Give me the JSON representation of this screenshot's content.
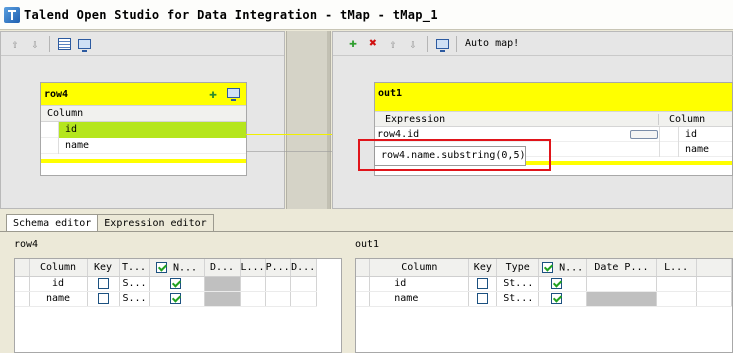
{
  "window": {
    "title": "Talend Open Studio for Data Integration - tMap - tMap_1"
  },
  "left_toolbar": {
    "icons": [
      "arrow-up-icon",
      "arrow-down-icon",
      "table-icon",
      "screen-icon"
    ]
  },
  "right_toolbar": {
    "icons": [
      "add-icon",
      "delete-icon",
      "arrow-up-icon",
      "arrow-down-icon",
      "screen-icon"
    ],
    "auto_map_label": "Auto map!"
  },
  "input_table": {
    "name": "row4",
    "column_header": "Column",
    "rows": [
      {
        "column": "id",
        "selected": true
      },
      {
        "column": "name",
        "selected": false
      }
    ]
  },
  "output_table": {
    "name": "out1",
    "expression_header": "Expression",
    "column_header": "Column",
    "rows": [
      {
        "expression": "row4.id",
        "column": "id"
      },
      {
        "expression": "row4.name.substring(0,5)",
        "column": "name"
      }
    ]
  },
  "editor_tabs": [
    {
      "label": "Schema editor",
      "active": true
    },
    {
      "label": "Expression editor",
      "active": false
    }
  ],
  "schema_left": {
    "title": "row4",
    "headers": [
      "Column",
      "Key",
      "T...",
      "N...",
      "D...",
      "L...",
      "P...",
      "D..."
    ],
    "rows": [
      {
        "column": "id",
        "type": "S...",
        "nullable": true
      },
      {
        "column": "name",
        "type": "S...",
        "nullable": true
      }
    ]
  },
  "schema_right": {
    "title": "out1",
    "headers": [
      "Column",
      "Key",
      "Type",
      "N...",
      "Date P...",
      "L..."
    ],
    "rows": [
      {
        "column": "id",
        "type": "St...",
        "nullable": true
      },
      {
        "column": "name",
        "type": "St...",
        "nullable": true
      }
    ]
  },
  "colors": {
    "header_yellow": "#ffff00",
    "selected_green": "#b5e61d",
    "highlight_red": "#e0141a",
    "link_line": "#f0f000"
  }
}
